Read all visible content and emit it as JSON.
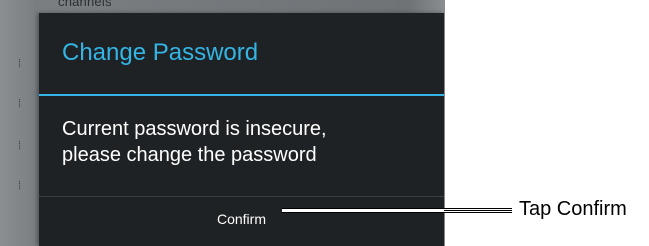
{
  "background": {
    "partial_text": "channels"
  },
  "dialog": {
    "title": "Change Password",
    "message_line1": "Current password is insecure,",
    "message_line2": "please change the password",
    "confirm_label": "Confirm"
  },
  "callout": {
    "text": "Tap Confirm"
  },
  "colors": {
    "accent": "#33b5e5",
    "dialog_bg": "#1f2224",
    "text": "#ffffff"
  }
}
